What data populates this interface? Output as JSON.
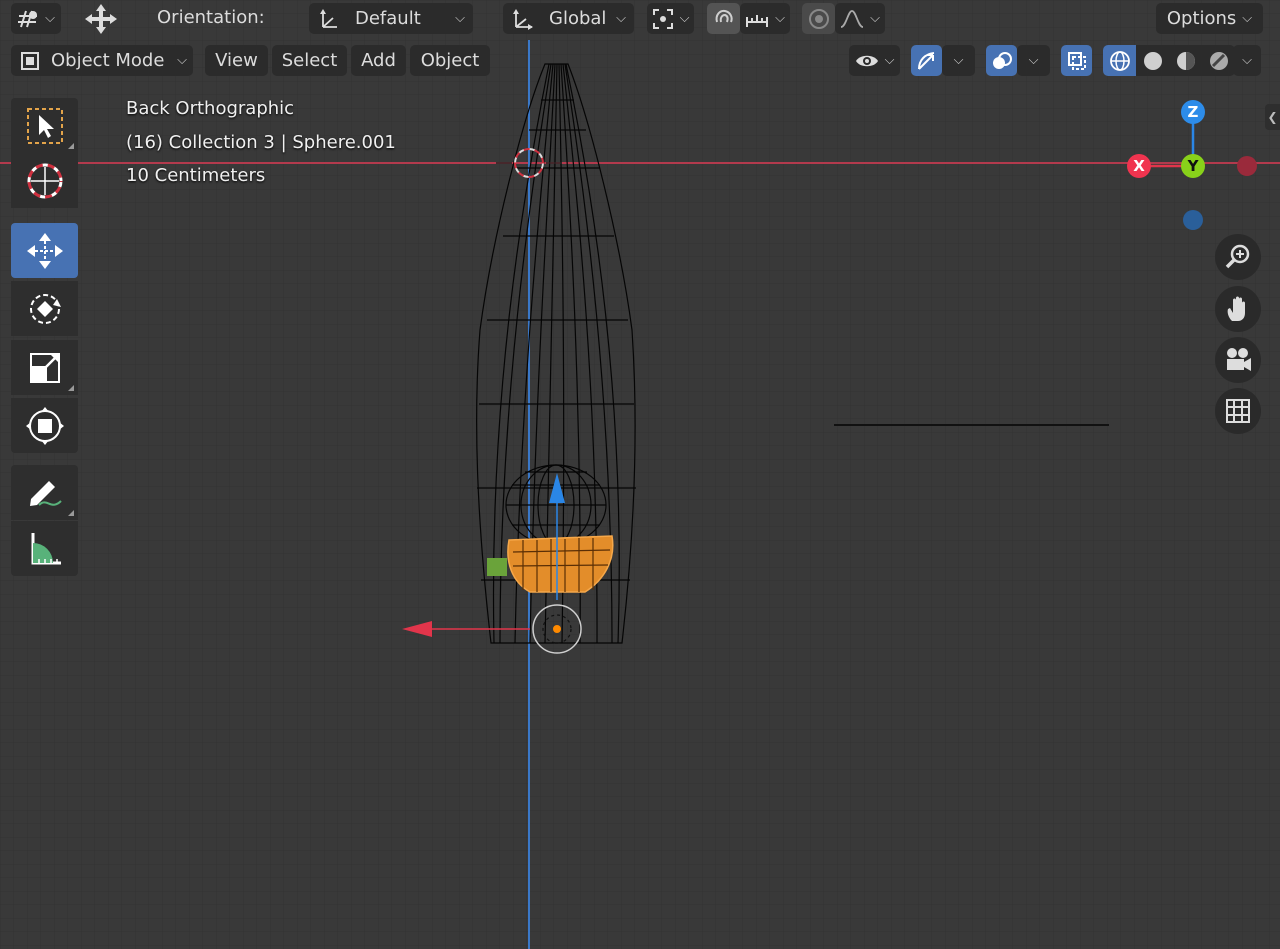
{
  "header": {
    "orientation_label": "Orientation:",
    "orientation_value": "Default",
    "transform_space": "Global",
    "options_label": "Options"
  },
  "menu": {
    "mode": "Object Mode",
    "view": "View",
    "select": "Select",
    "add": "Add",
    "object": "Object"
  },
  "viewport_overlay": {
    "view_name": "Back Orthographic",
    "collection_info": "(16) Collection 3 | Sphere.001",
    "scale_info": "10 Centimeters"
  },
  "gizmo": {
    "z_label": "Z",
    "x_label": "X",
    "y_label": "Y"
  },
  "toolbar": {
    "tools": [
      "select-box",
      "cursor",
      "move",
      "rotate",
      "scale",
      "transform",
      "annotate",
      "measure"
    ],
    "active_tool": "move"
  },
  "colors": {
    "accent": "#4772b3",
    "selection_orange": "#f29d2b",
    "axis_red": "#ff3352",
    "axis_green": "#8bdc00",
    "axis_blue": "#2890ff",
    "viewport_bg": "#393939"
  }
}
